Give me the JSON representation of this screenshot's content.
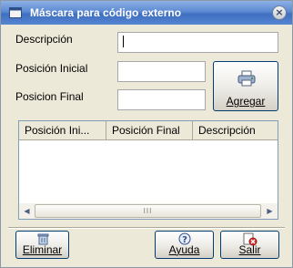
{
  "window": {
    "title": "Máscara para código externo",
    "close_label": "×"
  },
  "form": {
    "descripcion_label": "Descripción",
    "posicion_inicial_label": "Posición Inicial",
    "posicion_final_label": "Posicion Final",
    "descripcion_value": "",
    "posicion_inicial_value": "",
    "posicion_final_value": ""
  },
  "buttons": {
    "agregar": "Agregar",
    "eliminar": "Eliminar",
    "ayuda": "Ayuda",
    "salir": "Salir"
  },
  "grid": {
    "columns": [
      "Posición Ini...",
      "Posición Final",
      "Descripción"
    ],
    "rows": [],
    "thumb_grip": "III"
  },
  "icons": {
    "title": "window-icon",
    "agregar": "printer-icon",
    "eliminar": "trash-icon",
    "ayuda": "help-icon",
    "salir": "exit-icon"
  }
}
